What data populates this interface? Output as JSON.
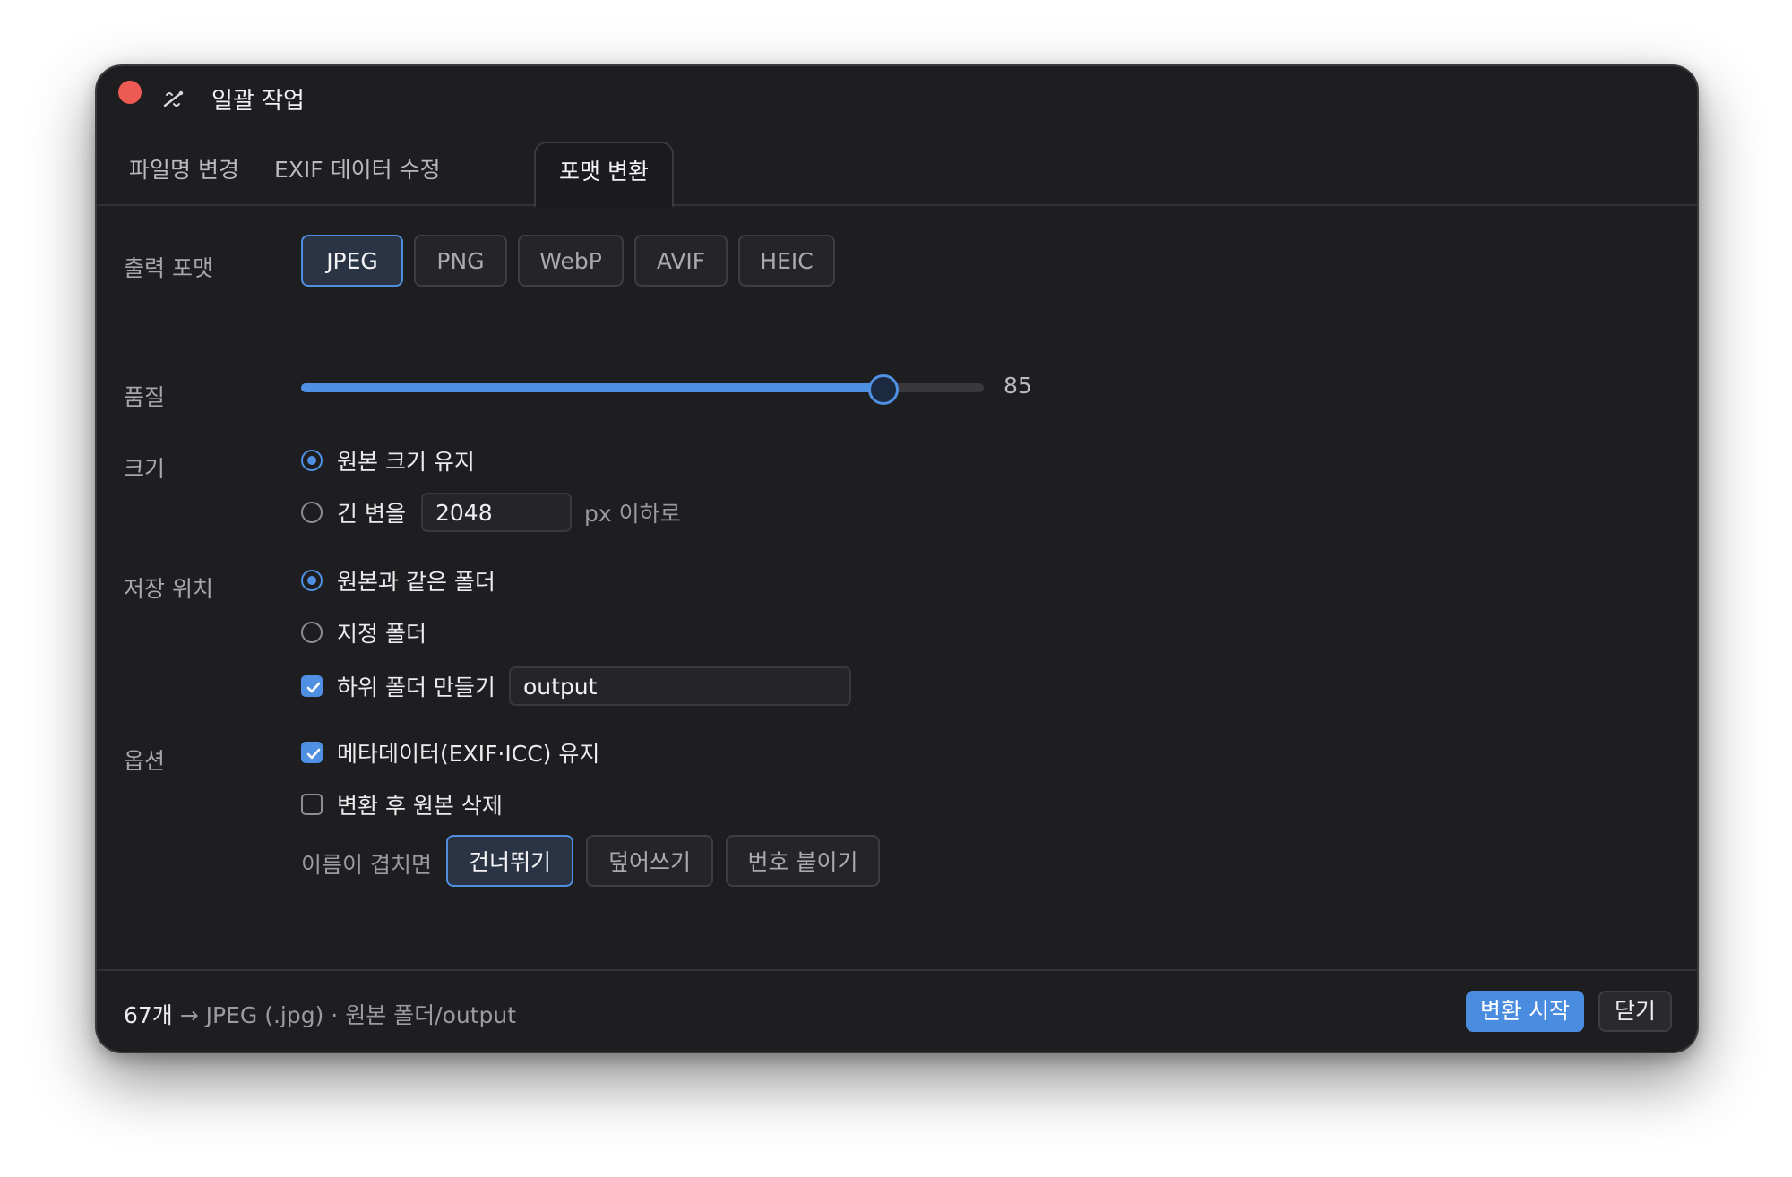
{
  "window": {
    "title": "일괄 작업",
    "title_icon": "wand-icon"
  },
  "tabs": [
    {
      "label": "파일명 변경",
      "active": false
    },
    {
      "label": "EXIF 데이터 수정",
      "active": false
    },
    {
      "label": "포맷 변환",
      "active": true
    }
  ],
  "format": {
    "label": "출력 포맷",
    "options": [
      "JPEG",
      "PNG",
      "WebP",
      "AVIF",
      "HEIC"
    ],
    "selected": "JPEG"
  },
  "quality": {
    "label": "품질",
    "value": "85",
    "percent": 85
  },
  "size": {
    "label": "크기",
    "keep_original": "원본 크기 유지",
    "long_side": "긴 변을",
    "long_side_value": "2048",
    "long_side_suffix": "px 이하로",
    "selected": "keep_original"
  },
  "save_location": {
    "label": "저장 위치",
    "same_folder": "원본과 같은 폴더",
    "custom_folder": "지정 폴더",
    "subfolder": "하위 폴더 만들기",
    "subfolder_name": "output",
    "selected": "same_folder",
    "subfolder_checked": true
  },
  "options": {
    "label": "옵션",
    "keep_metadata": "메타데이터(EXIF·ICC) 유지",
    "keep_metadata_checked": true,
    "delete_original": "변환 후 원본 삭제",
    "delete_original_checked": false,
    "conflict_label": "이름이 겹치면",
    "conflict_options": [
      "건너뛰기",
      "덮어쓰기",
      "번호 붙이기"
    ],
    "conflict_selected": "건너뛰기"
  },
  "footer": {
    "count": "67개",
    "summary": " → JPEG (.jpg) · 원본 폴더/output",
    "start_button": "변환 시작",
    "close_button": "닫기"
  },
  "colors": {
    "accent": "#4f90e2",
    "close_dot": "#ed5a54",
    "window_bg": "#1e1e20"
  }
}
